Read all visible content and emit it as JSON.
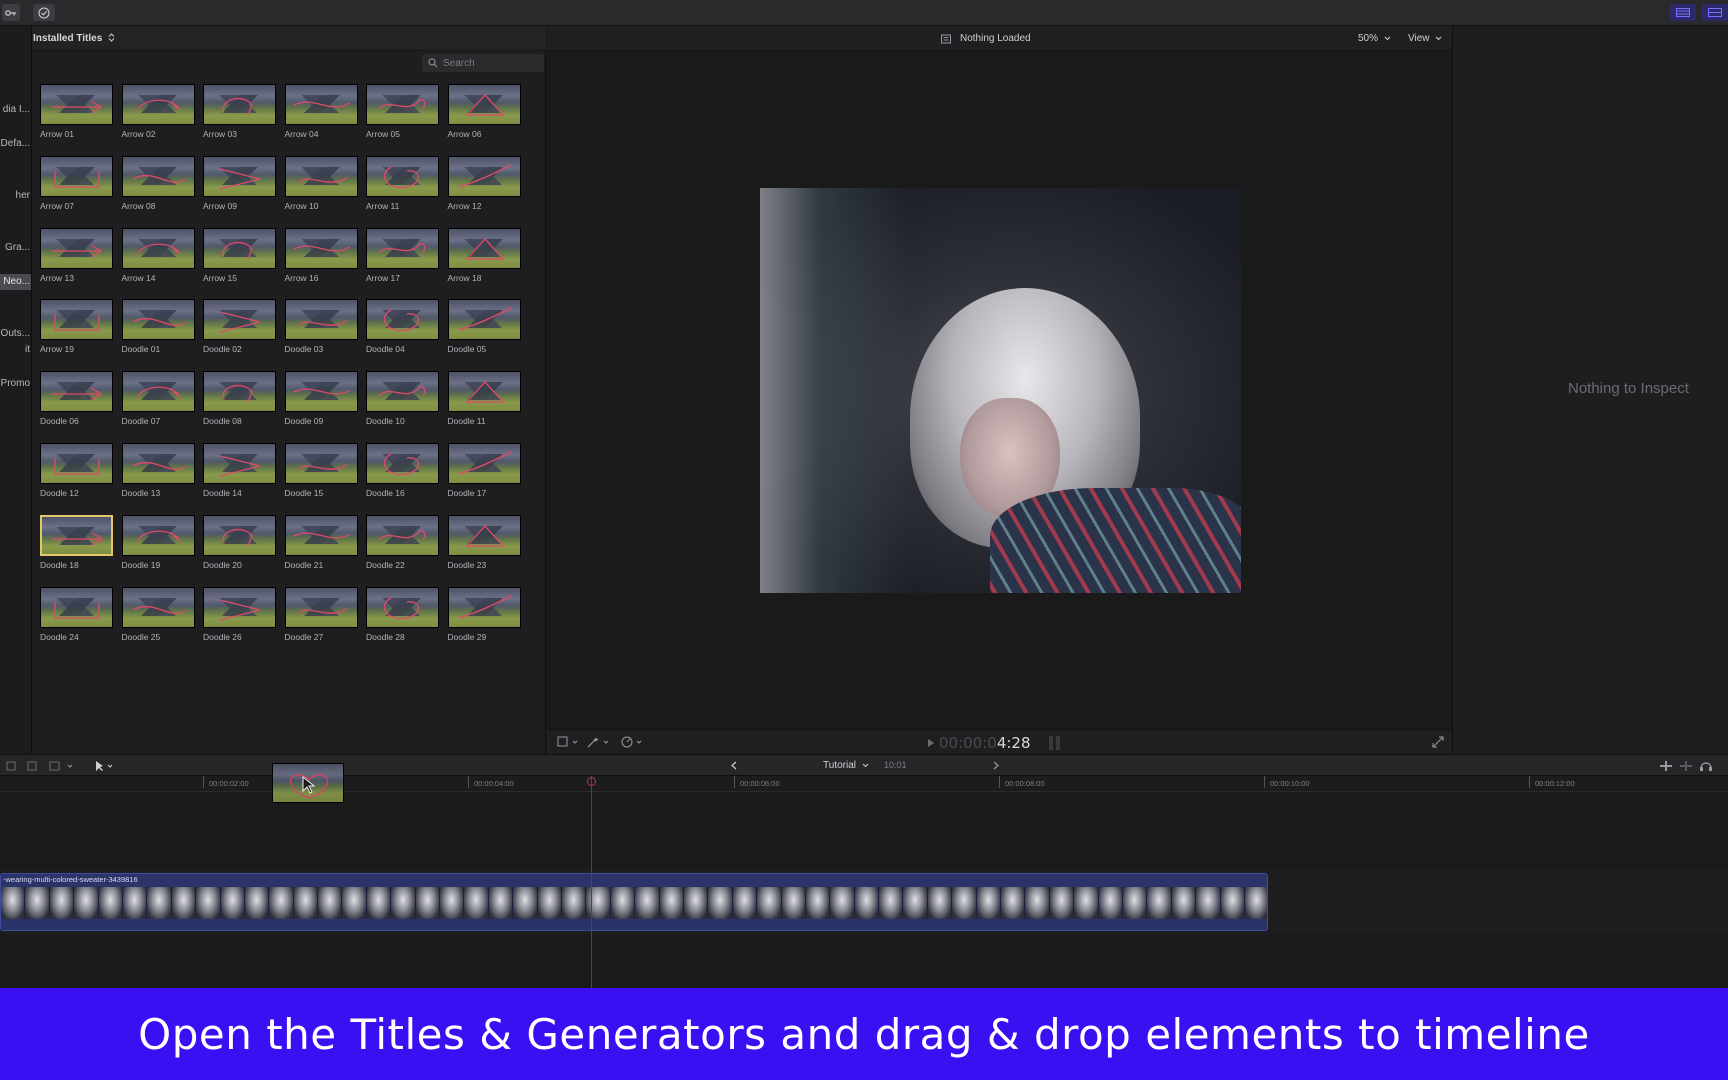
{
  "browser": {
    "title": "Installed Titles",
    "search_placeholder": "Search",
    "thumbnails": [
      "Arrow 01",
      "Arrow 02",
      "Arrow 03",
      "Arrow 04",
      "Arrow 05",
      "Arrow 06",
      "Arrow 07",
      "Arrow 08",
      "Arrow 09",
      "Arrow 10",
      "Arrow 11",
      "Arrow 12",
      "Arrow 13",
      "Arrow 14",
      "Arrow 15",
      "Arrow 16",
      "Arrow 17",
      "Arrow 18",
      "Arrow 19",
      "Doodle 01",
      "Doodle 02",
      "Doodle 03",
      "Doodle 04",
      "Doodle 05",
      "Doodle 06",
      "Doodle 07",
      "Doodle 08",
      "Doodle 09",
      "Doodle 10",
      "Doodle 11",
      "Doodle 12",
      "Doodle 13",
      "Doodle 14",
      "Doodle 15",
      "Doodle 16",
      "Doodle 17",
      "Doodle 18",
      "Doodle 19",
      "Doodle 20",
      "Doodle 21",
      "Doodle 22",
      "Doodle 23",
      "Doodle 24",
      "Doodle 25",
      "Doodle 26",
      "Doodle 27",
      "Doodle 28",
      "Doodle 29"
    ],
    "selected": "Doodle 18"
  },
  "sidebar": {
    "items": [
      "dia I...",
      "Defa...",
      "her",
      "Gra...",
      "Neo...",
      "Outs...",
      "it",
      "Promo"
    ],
    "selected": "Neo..."
  },
  "viewer": {
    "status": "Nothing Loaded",
    "zoom": "50%",
    "view_label": "View",
    "timecode_dim": "00:00:0",
    "timecode": "4:28"
  },
  "inspector": {
    "empty_text": "Nothing to Inspect"
  },
  "timeline": {
    "project_name": "Tutorial",
    "duration": "10:01",
    "ruler": [
      "00:00:02:00",
      "00:00:04:00",
      "00:00:06:00",
      "00:00:08:00",
      "00:00:10:00",
      "00:00:12:00"
    ],
    "clip_name": "-wearing-multi-colored-sweater-3439816"
  },
  "caption": "Open the Titles & Generators and drag & drop elements to timeline",
  "colors": {
    "caption_bg": "#3a10f2",
    "clip_bg": "#2a3469",
    "doodle_stroke": "#e04a6a",
    "selected_border": "#e3c66a"
  }
}
